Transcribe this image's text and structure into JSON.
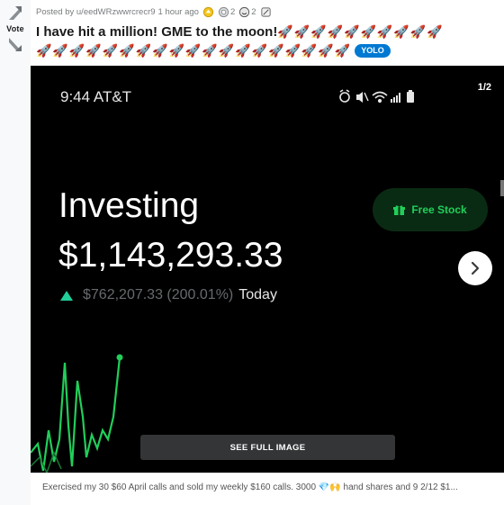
{
  "vote": {
    "label": "Vote"
  },
  "post": {
    "meta": {
      "prefix": "Posted by",
      "author": "u/eedWRzwwrcrecr9",
      "time": "1 hour ago",
      "awards": [
        {
          "icon": "gold-award-icon",
          "count": ""
        },
        {
          "icon": "silver-award-icon",
          "count": "2"
        },
        {
          "icon": "wholesome-award-icon",
          "count": "2"
        },
        {
          "icon": "rocket-like-award-icon",
          "count": ""
        }
      ]
    },
    "title": "I have hit a million! GME to the moon!",
    "rockets_line1": "🚀🚀🚀🚀🚀🚀🚀🚀🚀🚀",
    "rockets_line2": "🚀🚀🚀🚀🚀🚀🚀🚀🚀🚀🚀🚀🚀🚀🚀🚀🚀🚀🚀",
    "flair": "YOLO"
  },
  "media": {
    "status_time": "9:44 AT&T",
    "page_indicator": "1/2",
    "investing_label": "Investing",
    "portfolio_value": "$1,143,293.33",
    "change_amount": "$762,207.33 (200.01%)",
    "change_period": "Today",
    "free_stock_label": "Free Stock",
    "see_full_label": "SEE FULL IMAGE"
  },
  "caption": "Exercised my 30 $60 April calls and sold my weekly $160 calls. 3000 💎🙌 hand shares and 9 2/12 $1...",
  "colors": {
    "robinhood_green": "#21ce99",
    "flair_blue": "#0079d3",
    "free_stock_green": "#21ce5a"
  }
}
